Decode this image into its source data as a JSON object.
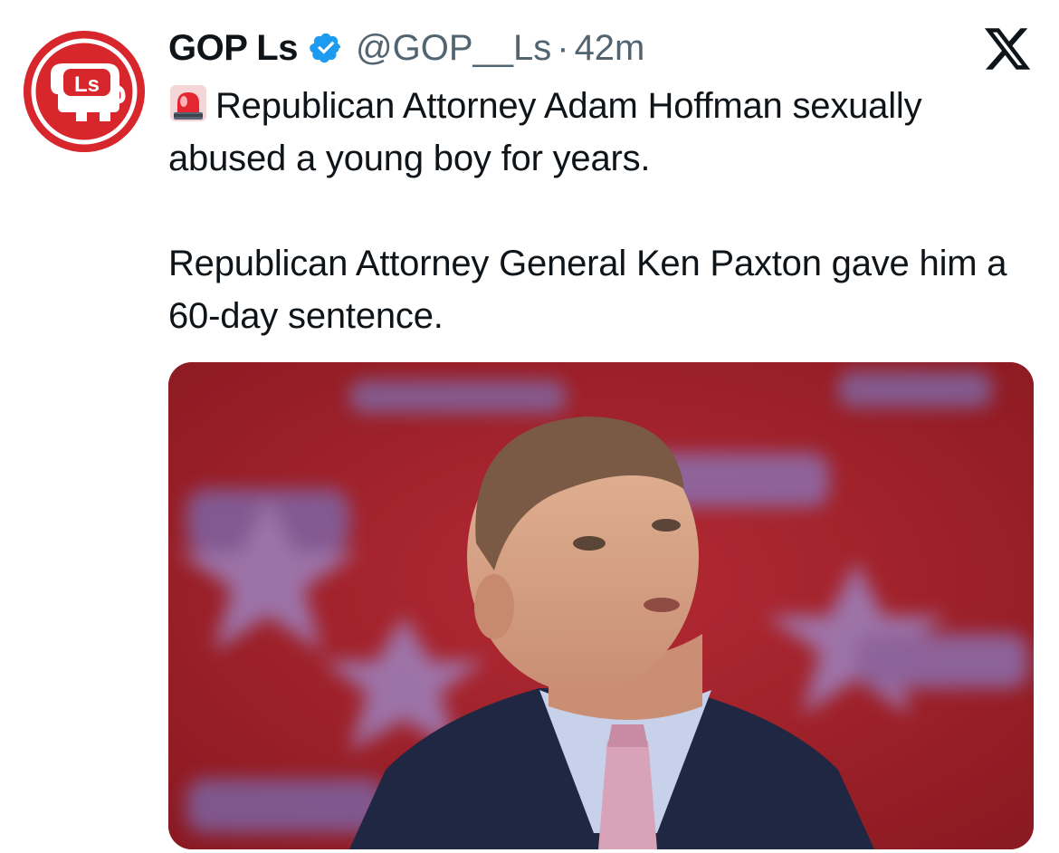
{
  "tweet": {
    "display_name": "GOP Ls",
    "handle": "@GOP__Ls",
    "separator": "·",
    "time": "42m",
    "text_line1": "Republican Attorney Adam Hoffman sexually abused a young boy for years.",
    "text_line2": "Republican Attorney General Ken Paxton gave him a 60-day sentence.",
    "emoji": "siren-icon"
  },
  "avatar": {
    "logo_text": "Ls",
    "background": "#d8262d"
  },
  "colors": {
    "verified": "#1d9bf0",
    "secondary_text": "#536471",
    "primary_text": "#0f1419"
  },
  "icons": {
    "close": "x-logo-icon",
    "verified": "verified-badge-icon"
  }
}
